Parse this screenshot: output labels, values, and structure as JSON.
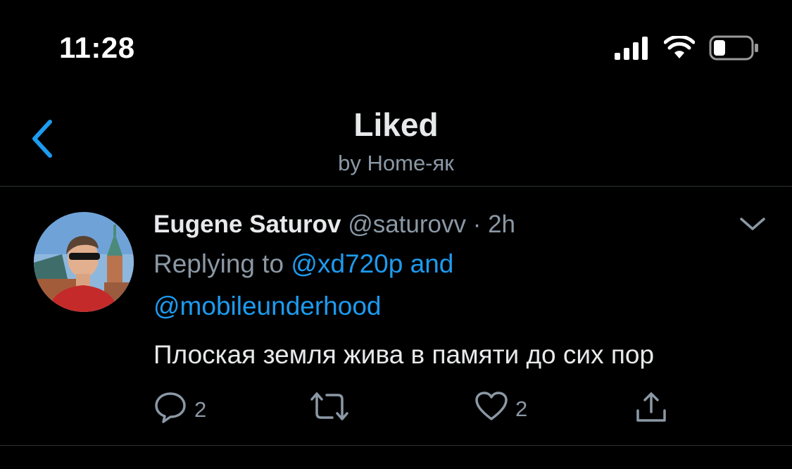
{
  "status_bar": {
    "time": "11:28"
  },
  "header": {
    "title": "Liked",
    "subtitle": "by Home-як",
    "back_icon": "chevron-left-icon"
  },
  "tweet": {
    "author_name": "Eugene Saturov",
    "handle_and_time": "@saturovv · 2h",
    "replying_prefix": "Replying to ",
    "replying_mentions_1": "@xd720p and",
    "replying_mentions_2": "@mobileunderhood",
    "text": "Плоская земля жива в памяти до сих пор",
    "actions": {
      "reply_count": "2",
      "retweet_count": "",
      "like_count": "2"
    }
  },
  "colors": {
    "background": "#000000",
    "accent": "#1d9bf0",
    "secondary_text": "#8b98a5",
    "divider": "#2f3336"
  }
}
